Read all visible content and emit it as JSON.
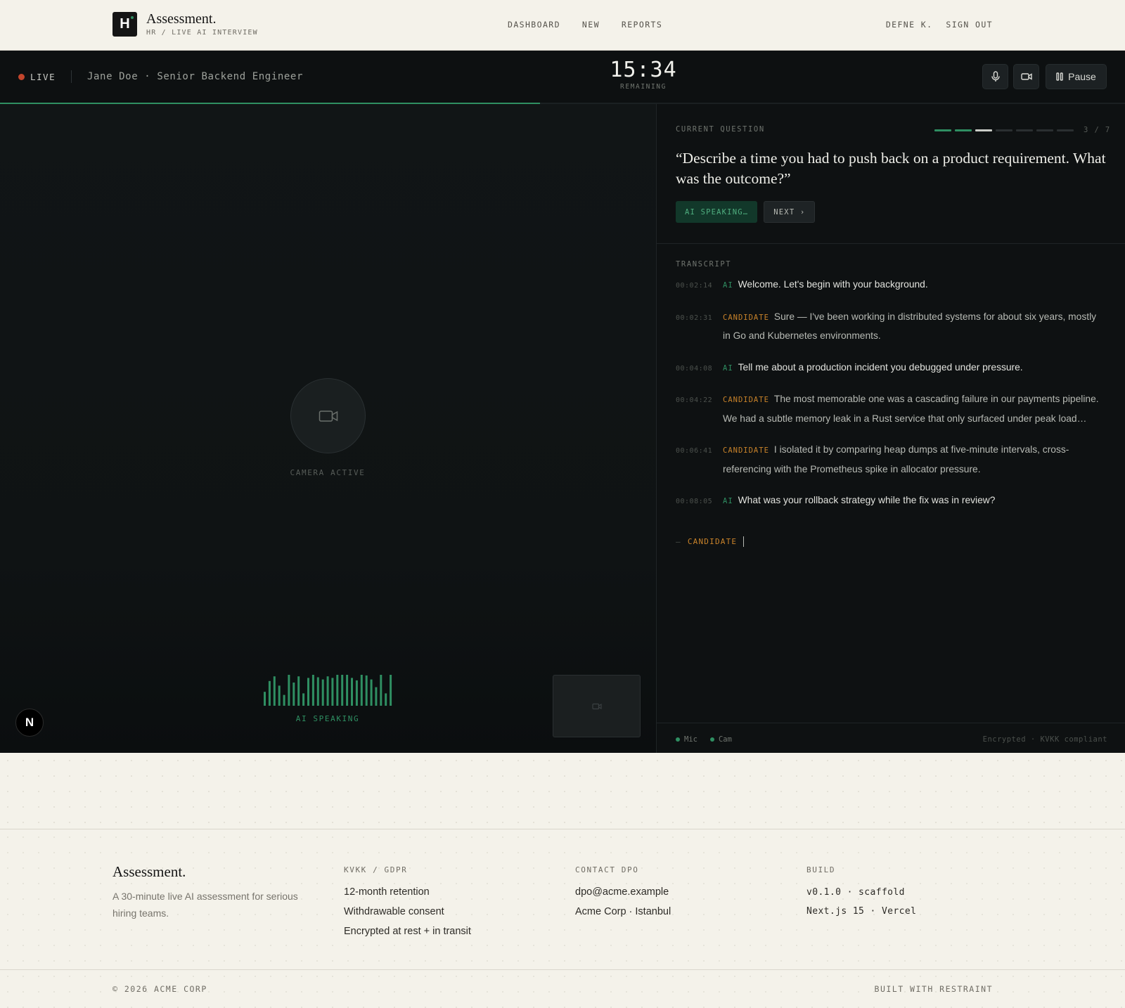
{
  "header": {
    "logo_letter": "H",
    "title": "Assessment.",
    "breadcrumb": "HR / LIVE AI INTERVIEW",
    "nav": [
      "DASHBOARD",
      "NEW",
      "REPORTS"
    ],
    "user": "DEFNE K.",
    "sign_out": "SIGN OUT"
  },
  "session": {
    "status": "LIVE",
    "candidate": "Jane Doe · Senior Backend Engineer",
    "timer": "15:34",
    "timer_label": "REMAINING",
    "pause_label": "Pause",
    "progress_fraction": 0.48,
    "colors": {
      "accent": "#2f8f62",
      "live": "#c2452c",
      "candidate": "#c9832a"
    }
  },
  "video": {
    "camera_label": "CAMERA ACTIVE",
    "badge_letter": "N",
    "speaking_label": "AI SPEAKING",
    "wave_levels": [
      0.45,
      0.8,
      0.95,
      0.65,
      0.35,
      1.0,
      0.75,
      0.95,
      0.4,
      0.9,
      1.0,
      0.92,
      0.85,
      0.95,
      0.9,
      1.0,
      1.0,
      1.0,
      0.9,
      0.82,
      1.0,
      0.98,
      0.85,
      0.6,
      1.0,
      0.4,
      1.0
    ]
  },
  "question": {
    "label": "CURRENT QUESTION",
    "current": 3,
    "total": 7,
    "count_text": "3 / 7",
    "text": "“Describe a time you had to push back on a product requirement. What was the outcome?”",
    "ai_speaking_label": "AI SPEAKING…",
    "next_label": "NEXT ›"
  },
  "transcript": {
    "label": "TRANSCRIPT",
    "entries": [
      {
        "time": "00:02:14",
        "speaker": "AI",
        "role": "ai",
        "text": "Welcome. Let's begin with your background."
      },
      {
        "time": "00:02:31",
        "speaker": "CANDIDATE",
        "role": "cand",
        "text": "Sure — I've been working in distributed systems for about six years, mostly in Go and Kubernetes environments."
      },
      {
        "time": "00:04:08",
        "speaker": "AI",
        "role": "ai",
        "text": "Tell me about a production incident you debugged under pressure."
      },
      {
        "time": "00:04:22",
        "speaker": "CANDIDATE",
        "role": "cand",
        "text": "The most memorable one was a cascading failure in our payments pipeline. We had a subtle memory leak in a Rust service that only surfaced under peak load…"
      },
      {
        "time": "00:06:41",
        "speaker": "CANDIDATE",
        "role": "cand",
        "text": "I isolated it by comparing heap dumps at five-minute intervals, cross-referencing with the Prometheus spike in allocator pressure."
      },
      {
        "time": "00:08:05",
        "speaker": "AI",
        "role": "ai",
        "text": "What was your rollback strategy while the fix was in review?"
      }
    ],
    "typing_dash": "—",
    "typing_speaker": "CANDIDATE"
  },
  "panel_footer": {
    "mic": "Mic",
    "cam": "Cam",
    "security": "Encrypted · KVKK compliant"
  },
  "footer": {
    "brand": "Assessment.",
    "description": "A 30-minute live AI assessment for serious hiring teams.",
    "columns": [
      {
        "heading": "KVKK / GDPR",
        "items": [
          "12-month retention",
          "Withdrawable consent",
          "Encrypted at rest + in transit"
        ]
      },
      {
        "heading": "CONTACT DPO",
        "items": [
          "dpo@acme.example",
          "Acme Corp · Istanbul"
        ]
      },
      {
        "heading": "BUILD",
        "items": [
          "v0.1.0 · scaffold",
          "Next.js 15 · Vercel"
        ]
      }
    ],
    "copyright": "© 2026 ACME CORP",
    "built_with": "BUILT WITH RESTRAINT"
  }
}
